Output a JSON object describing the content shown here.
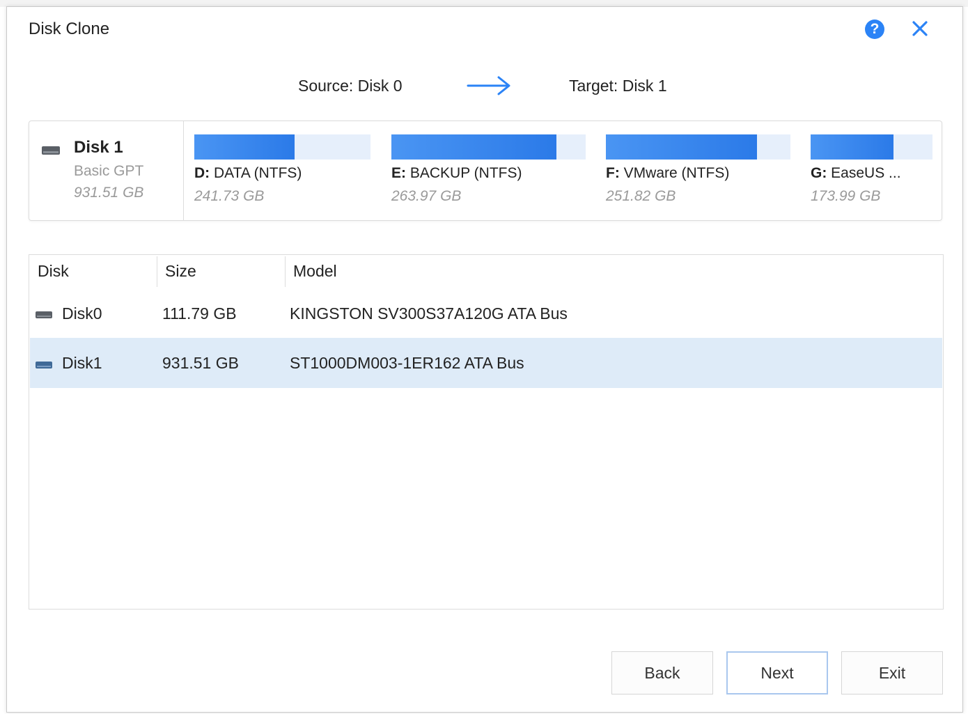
{
  "window": {
    "title": "Disk Clone"
  },
  "header": {
    "help_icon": "question-circle-icon",
    "help_glyph": "?",
    "close_icon": "close-x-icon",
    "source_label": "Source: Disk 0",
    "target_label": "Target: Disk 1",
    "arrow_icon": "right-arrow-icon"
  },
  "disk_map": {
    "disk_name": "Disk 1",
    "disk_type": "Basic GPT",
    "disk_size": "931.51 GB",
    "partitions": [
      {
        "letter": "D:",
        "name": "DATA (NTFS)",
        "size": "241.73 GB",
        "used_fraction": 0.57
      },
      {
        "letter": "E:",
        "name": "BACKUP (NTFS)",
        "size": "263.97 GB",
        "used_fraction": 0.85
      },
      {
        "letter": "F:",
        "name": "VMware (NTFS)",
        "size": "251.82 GB",
        "used_fraction": 0.82
      },
      {
        "letter": "G:",
        "name": "EaseUS ...",
        "size": "173.99 GB",
        "used_fraction": 0.68
      }
    ]
  },
  "table": {
    "headers": {
      "disk": "Disk",
      "size": "Size",
      "model": "Model"
    },
    "rows": [
      {
        "disk": "Disk0",
        "size": "111.79 GB",
        "model": "KINGSTON SV300S37A120G ATA Bus",
        "selected": false
      },
      {
        "disk": "Disk1",
        "size": "931.51 GB",
        "model": "ST1000DM003-1ER162 ATA Bus",
        "selected": true
      }
    ]
  },
  "buttons": {
    "back": "Back",
    "next": "Next",
    "exit": "Exit"
  },
  "colors": {
    "accent": "#2b83f6",
    "partition_used": "#3a87ef",
    "partition_free": "#e6effb",
    "row_selected": "#deebf8"
  }
}
